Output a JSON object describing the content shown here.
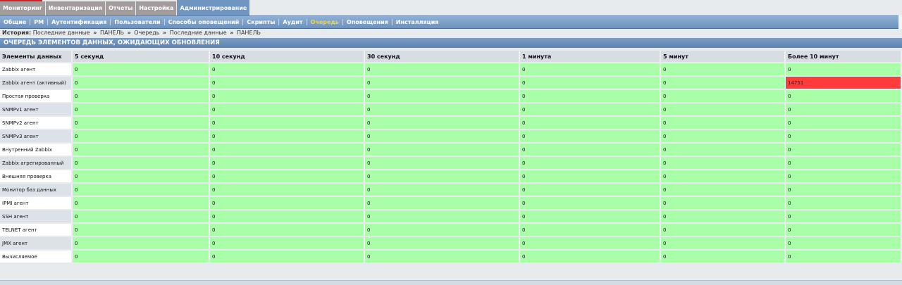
{
  "main_menu": [
    {
      "label": "Мониторинг",
      "active": false
    },
    {
      "label": "Инвентаризация",
      "active": false
    },
    {
      "label": "Отчеты",
      "active": false
    },
    {
      "label": "Настройка",
      "active": false
    },
    {
      "label": "Администрирование",
      "active": true
    }
  ],
  "sub_menu": [
    {
      "label": "Общие",
      "active": false
    },
    {
      "label": "РМ",
      "active": false
    },
    {
      "label": "Аутентификация",
      "active": false
    },
    {
      "label": "Пользователи",
      "active": false
    },
    {
      "label": "Способы оповещений",
      "active": false
    },
    {
      "label": "Скрипты",
      "active": false
    },
    {
      "label": "Аудит",
      "active": false
    },
    {
      "label": "Очередь",
      "active": true
    },
    {
      "label": "Оповещения",
      "active": false
    },
    {
      "label": "Инсталляция",
      "active": false
    }
  ],
  "history": {
    "label": "История:",
    "separator": "»",
    "items": [
      "Последние данные",
      "ПАНЕЛЬ",
      "Очередь",
      "Последние данные",
      "ПАНЕЛЬ"
    ]
  },
  "page_title": "ОЧЕРЕДЬ ЭЛЕМЕНТОВ ДАННЫХ, ОЖИДАЮЩИХ ОБНОВЛЕНИЯ",
  "table": {
    "columns": [
      "Элементы данных",
      "5 секунд",
      "10 секунд",
      "30 секунд",
      "1 минута",
      "5 минут",
      "Более 10 минут"
    ],
    "rows": [
      {
        "name": "Zabbix агент",
        "values": [
          "0",
          "0",
          "0",
          "0",
          "0",
          "0"
        ]
      },
      {
        "name": "Zabbix агент (активный)",
        "values": [
          "0",
          "0",
          "0",
          "0",
          "0",
          "14751"
        ]
      },
      {
        "name": "Простая проверка",
        "values": [
          "0",
          "0",
          "0",
          "0",
          "0",
          "0"
        ]
      },
      {
        "name": "SNMPv1 агент",
        "values": [
          "0",
          "0",
          "0",
          "0",
          "0",
          "0"
        ]
      },
      {
        "name": "SNMPv2 агент",
        "values": [
          "0",
          "0",
          "0",
          "0",
          "0",
          "0"
        ]
      },
      {
        "name": "SNMPv3 агент",
        "values": [
          "0",
          "0",
          "0",
          "0",
          "0",
          "0"
        ]
      },
      {
        "name": "Внутренний Zabbix",
        "values": [
          "0",
          "0",
          "0",
          "0",
          "0",
          "0"
        ]
      },
      {
        "name": "Zabbix агрегированный",
        "values": [
          "0",
          "0",
          "0",
          "0",
          "0",
          "0"
        ],
        "selected": true
      },
      {
        "name": "Внешняя проверка",
        "values": [
          "0",
          "0",
          "0",
          "0",
          "0",
          "0"
        ]
      },
      {
        "name": "Монитор баз данных",
        "values": [
          "0",
          "0",
          "0",
          "0",
          "0",
          "0"
        ]
      },
      {
        "name": "IPMI агент",
        "values": [
          "0",
          "0",
          "0",
          "0",
          "0",
          "0"
        ]
      },
      {
        "name": "SSH агент",
        "values": [
          "0",
          "0",
          "0",
          "0",
          "0",
          "0"
        ]
      },
      {
        "name": "TELNET агент",
        "values": [
          "0",
          "0",
          "0",
          "0",
          "0",
          "0"
        ]
      },
      {
        "name": "JMX агент",
        "values": [
          "0",
          "0",
          "0",
          "0",
          "0",
          "0"
        ]
      },
      {
        "name": "Вычисляемое",
        "values": [
          "0",
          "0",
          "0",
          "0",
          "0",
          "0"
        ]
      }
    ]
  },
  "colors": {
    "ok_cell": "#a8ffa8",
    "alert_cell": "#ff3b3b",
    "active_submenu": "#f5d53a",
    "header_bar": "#6a8fba"
  }
}
